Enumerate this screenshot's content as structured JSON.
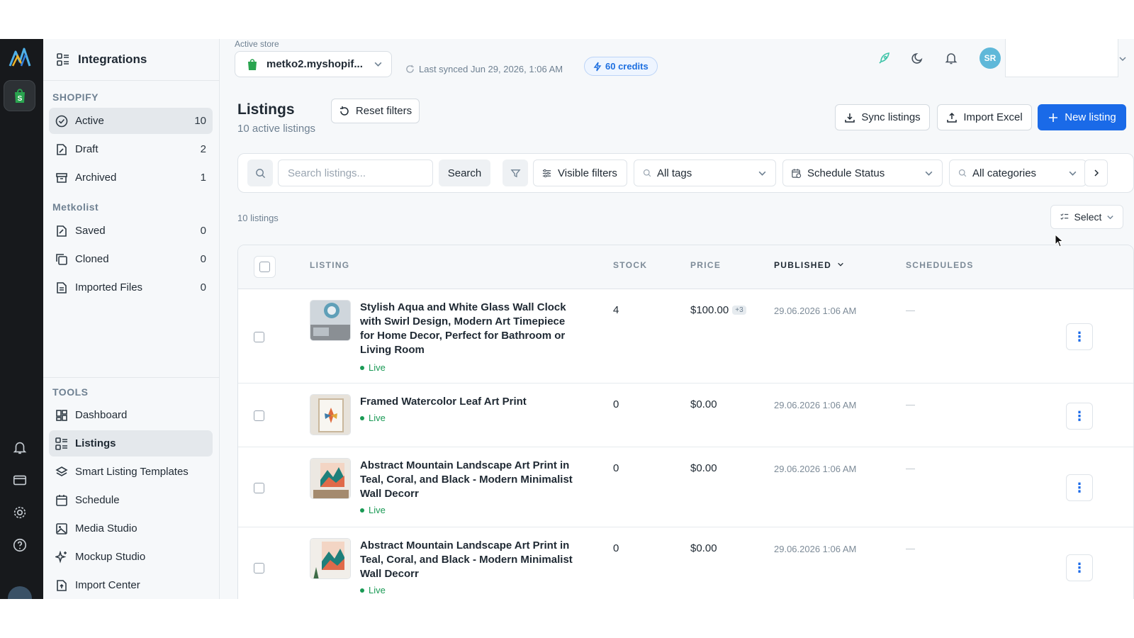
{
  "sidebar": {
    "title": "Integrations",
    "shopify_section": "SHOPIFY",
    "shopify_items": [
      {
        "label": "Active",
        "count": "10"
      },
      {
        "label": "Draft",
        "count": "2"
      },
      {
        "label": "Archived",
        "count": "1"
      }
    ],
    "metkolist_section": "Metkolist",
    "metkolist_items": [
      {
        "label": "Saved",
        "count": "0"
      },
      {
        "label": "Cloned",
        "count": "0"
      },
      {
        "label": "Imported Files",
        "count": "0"
      }
    ],
    "tools_section": "TOOLS",
    "tools_items": [
      {
        "label": "Dashboard"
      },
      {
        "label": "Listings"
      },
      {
        "label": "Smart Listing Templates"
      },
      {
        "label": "Schedule"
      },
      {
        "label": "Media Studio"
      },
      {
        "label": "Mockup Studio"
      },
      {
        "label": "Import Center"
      }
    ]
  },
  "topbar": {
    "active_store_label": "Active store",
    "store_name": "metko2.myshopif...",
    "last_synced": "Last synced Jun 29, 2026, 1:06 AM",
    "credits": "60 credits",
    "user_initials": "SR"
  },
  "page": {
    "title": "Listings",
    "subtitle": "10 active listings",
    "reset_filters": "Reset filters",
    "sync_listings": "Sync listings",
    "import_excel": "Import Excel",
    "new_listing": "New listing"
  },
  "filters": {
    "search_placeholder": "Search listings...",
    "search_button": "Search",
    "visible_filters": "Visible filters",
    "all_tags": "All tags",
    "schedule_status": "Schedule Status",
    "all_categories": "All categories"
  },
  "list": {
    "count_label": "10 listings",
    "select_label": "Select",
    "columns": {
      "listing": "LISTING",
      "stock": "STOCK",
      "price": "PRICE",
      "published": "PUBLISHED",
      "scheduleds": "SCHEDULEDS"
    },
    "rows": [
      {
        "title": "Stylish Aqua and White Glass Wall Clock with Swirl Design, Modern Art Timepiece for Home Decor, Perfect for Bathroom or Living Room",
        "status": "Live",
        "stock": "4",
        "price": "$100.00",
        "price_more": "+3",
        "published": "29.06.2026 1:06 AM",
        "scheduled": "—"
      },
      {
        "title": "Framed Watercolor Leaf Art Print",
        "status": "Live",
        "stock": "0",
        "price": "$0.00",
        "published": "29.06.2026 1:06 AM",
        "scheduled": "—"
      },
      {
        "title": "Abstract Mountain Landscape Art Print in Teal, Coral, and Black - Modern Minimalist Wall Decorr",
        "status": "Live",
        "stock": "0",
        "price": "$0.00",
        "published": "29.06.2026 1:06 AM",
        "scheduled": "—"
      },
      {
        "title": "Abstract Mountain Landscape Art Print in Teal, Coral, and Black - Modern Minimalist Wall Decorr",
        "status": "Live",
        "stock": "0",
        "price": "$0.00",
        "published": "29.06.2026 1:06 AM",
        "scheduled": "—"
      }
    ]
  },
  "colors": {
    "primary": "#1a6ae8",
    "live": "#1a9a55",
    "rail": "#17191c",
    "shopify": "#2aa44f"
  }
}
